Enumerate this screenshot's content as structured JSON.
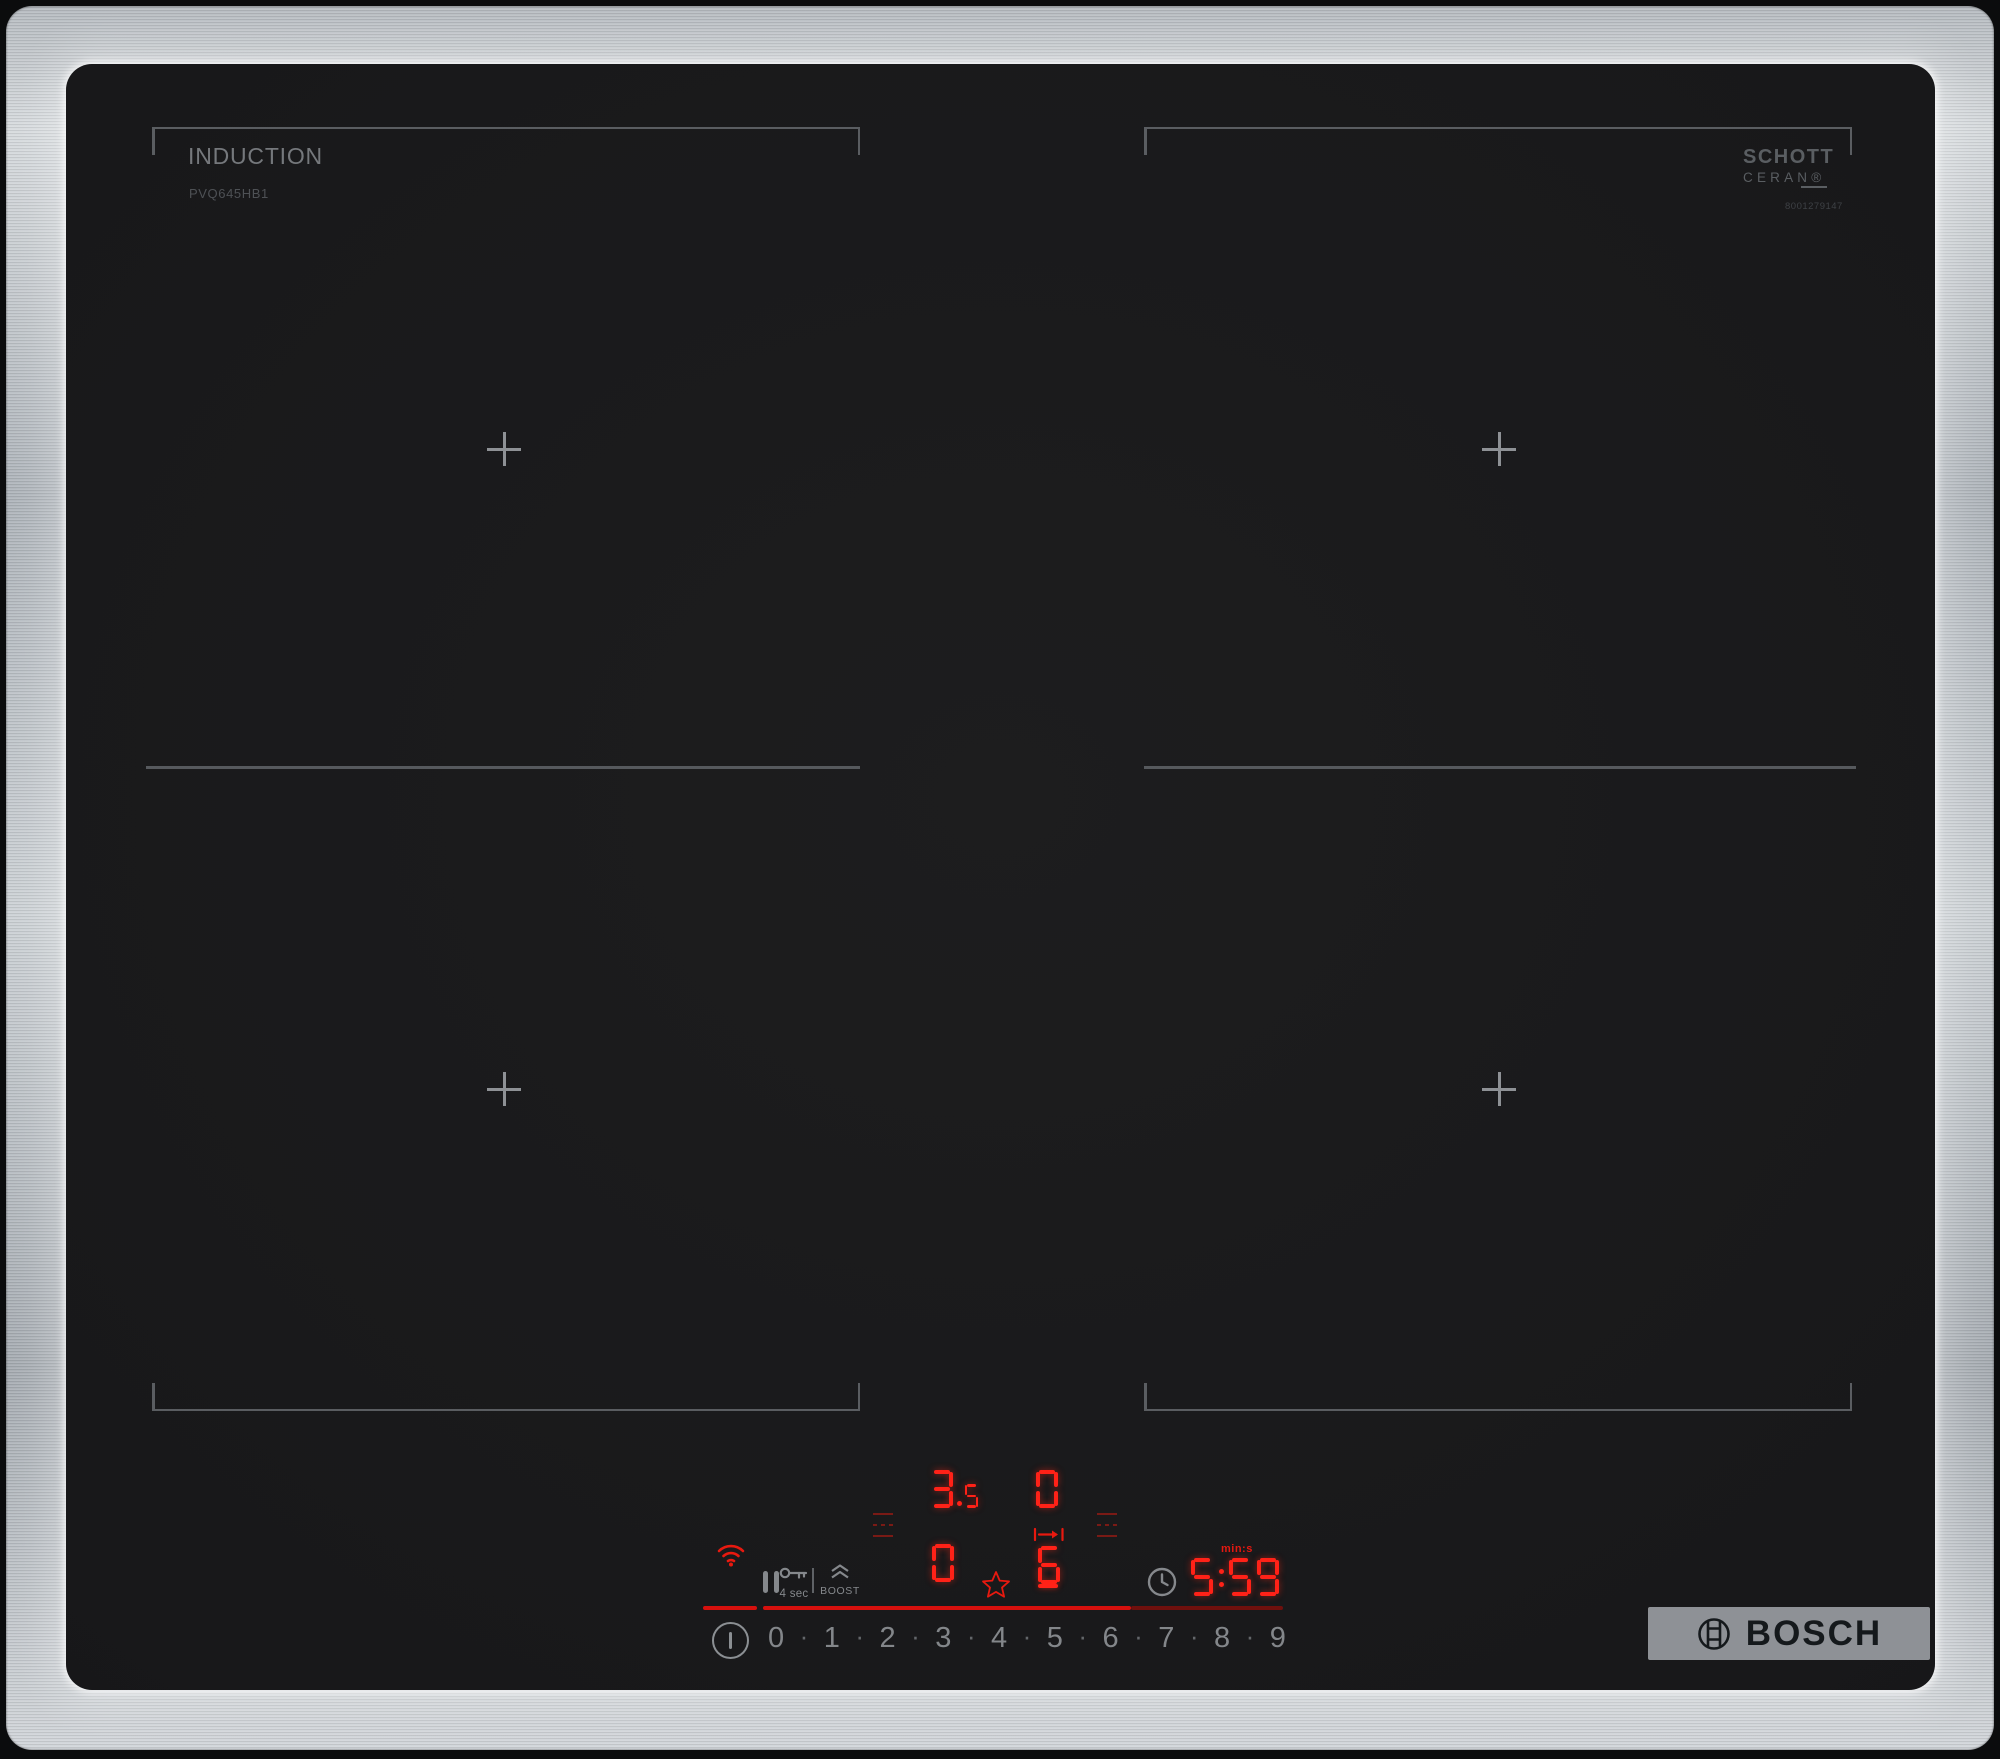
{
  "product": {
    "surface_label": "INDUCTION",
    "model_number": "PVQ645HB1",
    "glass_brand_line1": "SCHOTT",
    "glass_brand_line2": "CERAN®",
    "glass_serial": "8001279147",
    "manufacturer": "BOSCH"
  },
  "colors": {
    "led_red": "#ff2218",
    "dim_red": "#8c1a14",
    "icon_gray": "#85888c",
    "steel": "#c3c8cd",
    "glass_black": "#18181a"
  },
  "icons": {
    "wifi": "wifi-icon",
    "pause": "pause-icon",
    "key_lock": "key-icon",
    "boost_chevrons": "chevron-up-double-icon",
    "favorite": "star-icon",
    "timer_clock": "clock-icon",
    "move_zone": "move-zone-icon",
    "power": "power-icon",
    "bosch_emblem": "bosch-armature-icon"
  },
  "controls": {
    "key_lock_label": "4 sec",
    "boost_label": "BOOST",
    "timer": {
      "value": "5:59",
      "unit_label": "min:s"
    },
    "zones": {
      "rear_left": {
        "power": "3.5"
      },
      "rear_right": {
        "power": "0"
      },
      "front_left": {
        "power": "0"
      },
      "front_right": {
        "power": "6",
        "selected": true
      }
    },
    "power_levels": [
      "0",
      "1",
      "2",
      "3",
      "4",
      "5",
      "6",
      "7",
      "8",
      "9"
    ],
    "slider_active_level": "6"
  }
}
